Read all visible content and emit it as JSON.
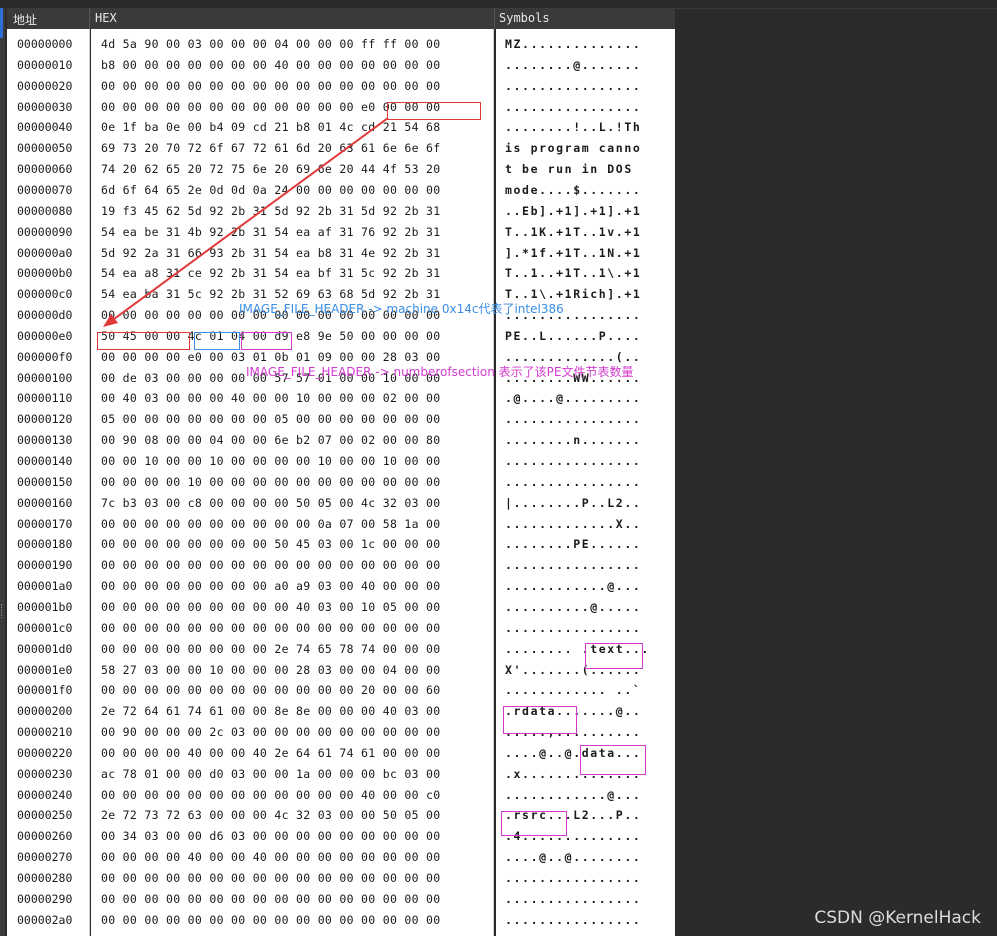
{
  "header": {
    "address_label": "地址",
    "hex_label": "HEX",
    "symbols_label": "Symbols"
  },
  "rows": [
    {
      "addr": "00000000",
      "hex": "4d 5a 90 00 03 00 00 00 04 00 00 00 ff ff 00 00",
      "sym": "MZ.............."
    },
    {
      "addr": "00000010",
      "hex": "b8 00 00 00 00 00 00 00 40 00 00 00 00 00 00 00",
      "sym": "........@......."
    },
    {
      "addr": "00000020",
      "hex": "00 00 00 00 00 00 00 00 00 00 00 00 00 00 00 00",
      "sym": "................"
    },
    {
      "addr": "00000030",
      "hex": "00 00 00 00 00 00 00 00 00 00 00 00 e0 00 00 00",
      "sym": "................"
    },
    {
      "addr": "00000040",
      "hex": "0e 1f ba 0e 00 b4 09 cd 21 b8 01 4c cd 21 54 68",
      "sym": "........!..L.!Th"
    },
    {
      "addr": "00000050",
      "hex": "69 73 20 70 72 6f 67 72 61 6d 20 63 61 6e 6e 6f",
      "sym": "is program canno"
    },
    {
      "addr": "00000060",
      "hex": "74 20 62 65 20 72 75 6e 20 69 6e 20 44 4f 53 20",
      "sym": "t be run in DOS "
    },
    {
      "addr": "00000070",
      "hex": "6d 6f 64 65 2e 0d 0d 0a 24 00 00 00 00 00 00 00",
      "sym": "mode....$......."
    },
    {
      "addr": "00000080",
      "hex": "19 f3 45 62 5d 92 2b 31 5d 92 2b 31 5d 92 2b 31",
      "sym": "..Eb].+1].+1].+1"
    },
    {
      "addr": "00000090",
      "hex": "54 ea be 31 4b 92 2b 31 54 ea af 31 76 92 2b 31",
      "sym": "T..1K.+1T..1v.+1"
    },
    {
      "addr": "000000a0",
      "hex": "5d 92 2a 31 66 93 2b 31 54 ea b8 31 4e 92 2b 31",
      "sym": "].*1f.+1T..1N.+1"
    },
    {
      "addr": "000000b0",
      "hex": "54 ea a8 31 ce 92 2b 31 54 ea bf 31 5c 92 2b 31",
      "sym": "T..1..+1T..1\\.+1"
    },
    {
      "addr": "000000c0",
      "hex": "54 ea ba 31 5c 92 2b 31 52 69 63 68 5d 92 2b 31",
      "sym": "T..1\\.+1Rich].+1"
    },
    {
      "addr": "000000d0",
      "hex": "00 00 00 00 00 00 00 00 00 00 00 00 00 00 00 00",
      "sym": "................"
    },
    {
      "addr": "000000e0",
      "hex": "50 45 00 00 4c 01 04 00 d9 e8 9e 50 00 00 00 00",
      "sym": "PE..L......P...."
    },
    {
      "addr": "000000f0",
      "hex": "00 00 00 00 e0 00 03 01 0b 01 09 00 00 28 03 00",
      "sym": ".............(.."
    },
    {
      "addr": "00000100",
      "hex": "00 de 03 00 00 00 00 00 57 57 01 00 00 10 00 00",
      "sym": "........WW......"
    },
    {
      "addr": "00000110",
      "hex": "00 40 03 00 00 00 40 00 00 10 00 00 00 02 00 00",
      "sym": ".@....@........."
    },
    {
      "addr": "00000120",
      "hex": "05 00 00 00 00 00 00 00 05 00 00 00 00 00 00 00",
      "sym": "................"
    },
    {
      "addr": "00000130",
      "hex": "00 90 08 00 00 04 00 00 6e b2 07 00 02 00 00 80",
      "sym": "........n......."
    },
    {
      "addr": "00000140",
      "hex": "00 00 10 00 00 10 00 00 00 00 10 00 00 10 00 00",
      "sym": "................"
    },
    {
      "addr": "00000150",
      "hex": "00 00 00 00 10 00 00 00 00 00 00 00 00 00 00 00",
      "sym": "................"
    },
    {
      "addr": "00000160",
      "hex": "7c b3 03 00 c8 00 00 00 00 50 05 00 4c 32 03 00",
      "sym": "|........P..L2.."
    },
    {
      "addr": "00000170",
      "hex": "00 00 00 00 00 00 00 00 00 00 0a 07 00 58 1a 00",
      "sym": ".............X.."
    },
    {
      "addr": "00000180",
      "hex": "00 00 00 00 00 00 00 00 50 45 03 00 1c 00 00 00",
      "sym": "........PE......"
    },
    {
      "addr": "00000190",
      "hex": "00 00 00 00 00 00 00 00 00 00 00 00 00 00 00 00",
      "sym": "................"
    },
    {
      "addr": "000001a0",
      "hex": "00 00 00 00 00 00 00 00 a0 a9 03 00 40 00 00 00",
      "sym": "............@..."
    },
    {
      "addr": "000001b0",
      "hex": "00 00 00 00 00 00 00 00 00 40 03 00 10 05 00 00",
      "sym": "..........@....."
    },
    {
      "addr": "000001c0",
      "hex": "00 00 00 00 00 00 00 00 00 00 00 00 00 00 00 00",
      "sym": "................"
    },
    {
      "addr": "000001d0",
      "hex": "00 00 00 00 00 00 00 00 2e 74 65 78 74 00 00 00",
      "sym": "........ .text..."
    },
    {
      "addr": "000001e0",
      "hex": "58 27 03 00 00 10 00 00 00 28 03 00 00 04 00 00",
      "sym": "X'.......(......"
    },
    {
      "addr": "000001f0",
      "hex": "00 00 00 00 00 00 00 00 00 00 00 00 20 00 00 60",
      "sym": "............ ..`"
    },
    {
      "addr": "00000200",
      "hex": "2e 72 64 61 74 61 00 00 8e 8e 00 00 00 40 03 00",
      "sym": ".rdata.......@.."
    },
    {
      "addr": "00000210",
      "hex": "00 90 00 00 00 2c 03 00 00 00 00 00 00 00 00 00",
      "sym": ".....,.........."
    },
    {
      "addr": "00000220",
      "hex": "00 00 00 00 40 00 00 40 2e 64 61 74 61 00 00 00",
      "sym": "....@..@.data..."
    },
    {
      "addr": "00000230",
      "hex": "ac 78 01 00 00 d0 03 00 00 1a 00 00 00 bc 03 00",
      "sym": ".x.............."
    },
    {
      "addr": "00000240",
      "hex": "00 00 00 00 00 00 00 00 00 00 00 00 40 00 00 c0",
      "sym": "............@..."
    },
    {
      "addr": "00000250",
      "hex": "2e 72 73 72 63 00 00 00 4c 32 03 00 00 50 05 00",
      "sym": ".rsrc...L2...P.."
    },
    {
      "addr": "00000260",
      "hex": "00 34 03 00 00 d6 03 00 00 00 00 00 00 00 00 00",
      "sym": ".4.............."
    },
    {
      "addr": "00000270",
      "hex": "00 00 00 00 40 00 00 40 00 00 00 00 00 00 00 00",
      "sym": "....@..@........"
    },
    {
      "addr": "00000280",
      "hex": "00 00 00 00 00 00 00 00 00 00 00 00 00 00 00 00",
      "sym": "................"
    },
    {
      "addr": "00000290",
      "hex": "00 00 00 00 00 00 00 00 00 00 00 00 00 00 00 00",
      "sym": "................"
    },
    {
      "addr": "000002a0",
      "hex": "00 00 00 00 00 00 00 00 00 00 00 00 00 00 00 00",
      "sym": "................"
    }
  ],
  "annotations": {
    "machine_note": "IMAGE_FILE_HEADER -> machine 0x14c代表了intel386",
    "sections_note": "IMAGE_FILE_HEADER -> numberofsection 表示了该PE文件节表数量"
  },
  "colors": {
    "red": "#e03a3a",
    "blue": "#3a8ee6",
    "magenta": "#d43ad0"
  },
  "watermark": "CSDN @KernelHack"
}
